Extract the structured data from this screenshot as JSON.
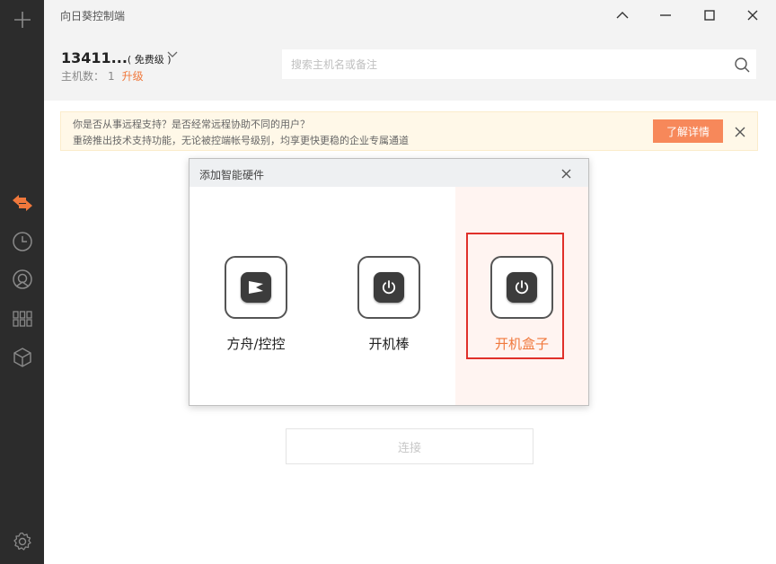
{
  "app": {
    "title": "向日葵控制端"
  },
  "window_controls": [
    {
      "name": "collapse-button",
      "icon": "chevron-up-icon"
    },
    {
      "name": "minimize-button",
      "icon": "minimize-icon"
    },
    {
      "name": "maximize-button",
      "icon": "maximize-icon"
    },
    {
      "name": "close-button",
      "icon": "close-icon"
    }
  ],
  "account": {
    "id": "13411...",
    "level": "( 免费级 )",
    "host_label": "主机数：",
    "host_count": "1",
    "upgrade": "升级"
  },
  "search": {
    "placeholder": "搜索主机名或备注",
    "value": ""
  },
  "banner": {
    "line1": "你是否从事远程支持？是否经常远程协助不同的用户？",
    "line2": "重磅推出技术支持功能，无论被控端帐号级别，均享更快更稳的企业专属通道",
    "button": "了解详情"
  },
  "main": {
    "connect_button": "连接"
  },
  "dialog": {
    "title": "添加智能硬件",
    "options": [
      {
        "label": "方舟/控控",
        "icon": "ark-play-icon"
      },
      {
        "label": "开机棒",
        "icon": "power-icon"
      },
      {
        "label": "开机盒子",
        "icon": "power-icon",
        "selected": true
      }
    ]
  },
  "sidebar": {
    "items": [
      {
        "name": "add-icon",
        "active": false
      },
      {
        "name": "remote-control-icon",
        "active": true
      },
      {
        "name": "history-clock-icon",
        "active": false
      },
      {
        "name": "discovery-icon",
        "active": false
      },
      {
        "name": "apps-grid-icon",
        "active": false
      },
      {
        "name": "hardware-box-icon",
        "active": false
      },
      {
        "name": "settings-gear-icon",
        "active": false
      }
    ]
  },
  "colors": {
    "accent": "#f0783c",
    "sidebar_bg": "#2c2c2c",
    "banner_bg": "#fff8e8",
    "selection_border": "#e0302a"
  }
}
